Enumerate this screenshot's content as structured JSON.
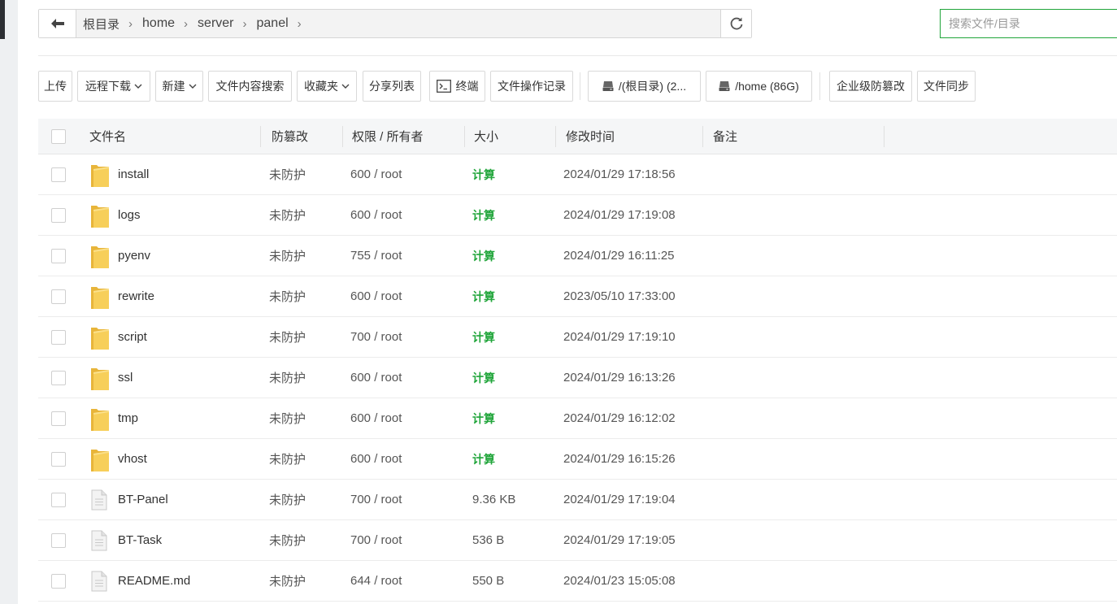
{
  "breadcrumb": [
    "根目录",
    "home",
    "server",
    "panel"
  ],
  "search": {
    "placeholder": "搜索文件/目录"
  },
  "toolbar": {
    "upload": "上传",
    "remote_download": "远程下载",
    "new": "新建",
    "content_search": "文件内容搜索",
    "favorites": "收藏夹",
    "share_list": "分享列表",
    "terminal": "终端",
    "operation_log": "文件操作记录",
    "disk_root": "/(根目录) (2...",
    "disk_home": "/home (86G)",
    "enterprise_tamper": "企业级防篡改",
    "file_sync": "文件同步"
  },
  "table": {
    "headers": {
      "name": "文件名",
      "tamper": "防篡改",
      "perm": "权限 / 所有者",
      "size": "大小",
      "mtime": "修改时间",
      "note": "备注"
    },
    "rows": [
      {
        "type": "folder",
        "name": "install",
        "tamper": "未防护",
        "perm": "600 / root",
        "size": "计算",
        "mtime": "2024/01/29 17:18:56",
        "note": ""
      },
      {
        "type": "folder",
        "name": "logs",
        "tamper": "未防护",
        "perm": "600 / root",
        "size": "计算",
        "mtime": "2024/01/29 17:19:08",
        "note": ""
      },
      {
        "type": "folder",
        "name": "pyenv",
        "tamper": "未防护",
        "perm": "755 / root",
        "size": "计算",
        "mtime": "2024/01/29 16:11:25",
        "note": ""
      },
      {
        "type": "folder",
        "name": "rewrite",
        "tamper": "未防护",
        "perm": "600 / root",
        "size": "计算",
        "mtime": "2023/05/10 17:33:00",
        "note": ""
      },
      {
        "type": "folder",
        "name": "script",
        "tamper": "未防护",
        "perm": "700 / root",
        "size": "计算",
        "mtime": "2024/01/29 17:19:10",
        "note": ""
      },
      {
        "type": "folder",
        "name": "ssl",
        "tamper": "未防护",
        "perm": "600 / root",
        "size": "计算",
        "mtime": "2024/01/29 16:13:26",
        "note": ""
      },
      {
        "type": "folder",
        "name": "tmp",
        "tamper": "未防护",
        "perm": "600 / root",
        "size": "计算",
        "mtime": "2024/01/29 16:12:02",
        "note": ""
      },
      {
        "type": "folder",
        "name": "vhost",
        "tamper": "未防护",
        "perm": "600 / root",
        "size": "计算",
        "mtime": "2024/01/29 16:15:26",
        "note": ""
      },
      {
        "type": "file",
        "name": "BT-Panel",
        "tamper": "未防护",
        "perm": "700 / root",
        "size": "9.36 KB",
        "mtime": "2024/01/29 17:19:04",
        "note": ""
      },
      {
        "type": "file",
        "name": "BT-Task",
        "tamper": "未防护",
        "perm": "700 / root",
        "size": "536 B",
        "mtime": "2024/01/29 17:19:05",
        "note": ""
      },
      {
        "type": "file",
        "name": "README.md",
        "tamper": "未防护",
        "perm": "644 / root",
        "size": "550 B",
        "mtime": "2024/01/23 15:05:08",
        "note": ""
      }
    ]
  },
  "colors": {
    "accent": "#20a53a",
    "folder": "#f5c242",
    "header_bg": "#f5f6f7"
  },
  "icons": {
    "back": "arrow-left-icon",
    "refresh": "refresh-icon",
    "terminal": "terminal-icon",
    "disk": "hard-drive-icon",
    "folder": "folder-icon",
    "file": "file-icon"
  }
}
